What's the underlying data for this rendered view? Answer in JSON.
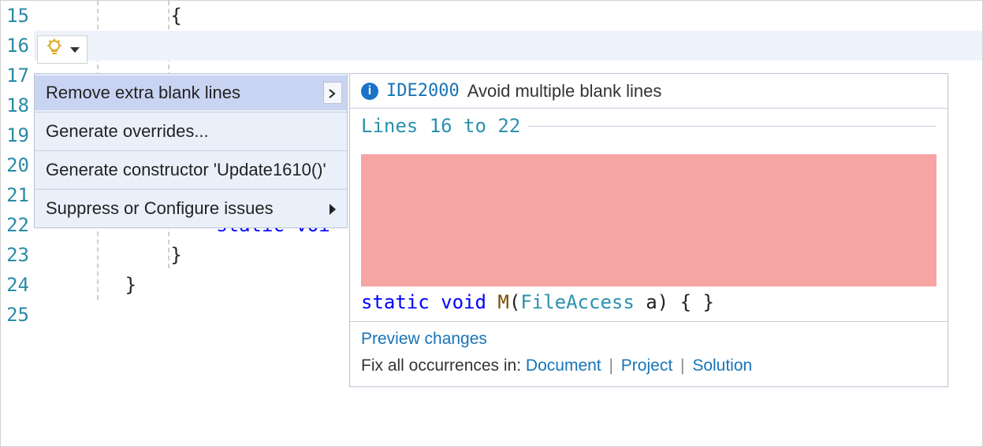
{
  "gutter": {
    "start": 15,
    "end": 25
  },
  "code": {
    "line15": "            {",
    "line16": "",
    "line22a": "                ",
    "line22_static": "static",
    "line22_void": " voi",
    "line23": "            }",
    "line24": "        }"
  },
  "menu": {
    "items": [
      {
        "label": "Remove extra blank lines",
        "selected": true,
        "submenu": true
      },
      {
        "label": "Generate overrides..."
      },
      {
        "label": "Generate constructor 'Update1610()'"
      },
      {
        "label": "Suppress or Configure issues",
        "submenu": true
      }
    ]
  },
  "preview": {
    "diag_code": "IDE2000",
    "diag_msg": "Avoid multiple blank lines",
    "lines_header": "Lines 16 to 22",
    "code": {
      "static": "static",
      "void": "void",
      "method": "M",
      "lparen": "(",
      "type": "FileAccess",
      "rest": " a) { }"
    },
    "footer": {
      "preview_link": "Preview changes",
      "fix_label": "Fix all occurrences in:",
      "document": "Document",
      "project": "Project",
      "solution": "Solution"
    }
  }
}
